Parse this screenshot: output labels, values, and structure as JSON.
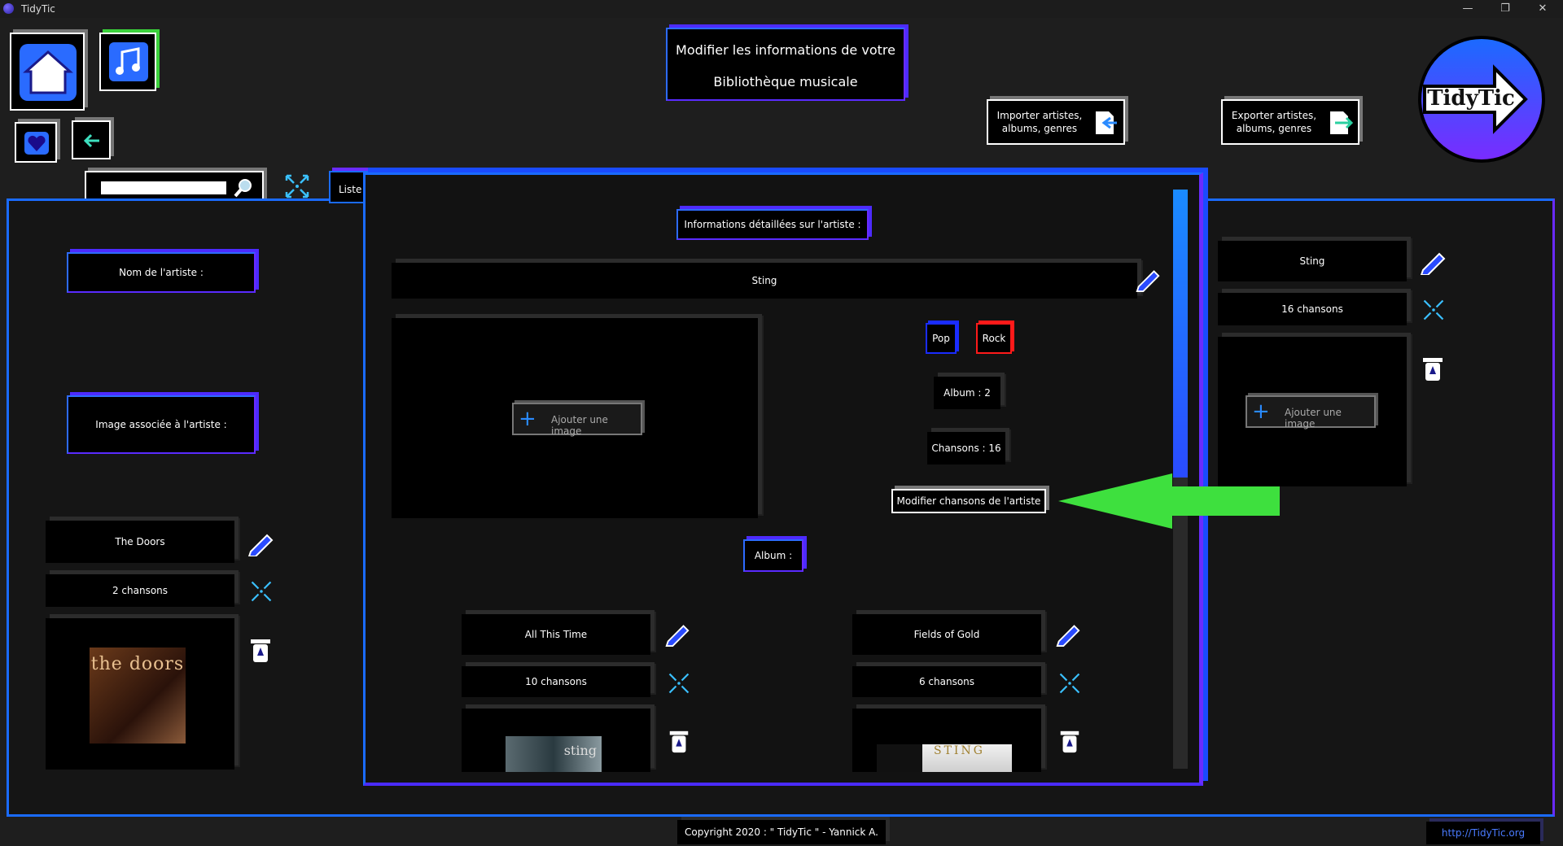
{
  "window": {
    "title": "TidyTic",
    "controls": [
      "—",
      "❐",
      "✕"
    ]
  },
  "header": {
    "title_line1": "Modifier les informations de votre",
    "title_line2": "Bibliothèque musicale",
    "import_label_line1": "Importer artistes,",
    "import_label_line2": "albums, genres",
    "export_label_line1": "Exporter artistes,",
    "export_label_line2": "albums, genres",
    "logo_text": "TidyTic"
  },
  "toolbar": {
    "search_value": "",
    "list_tab_label": "Liste"
  },
  "left_panel": {
    "artist_name_label": "Nom de l'artiste :",
    "artist_image_label": "Image associée à l'artiste :",
    "artist": {
      "name": "The Doors",
      "songs": "2 chansons",
      "cover_text": "the doors"
    }
  },
  "modal": {
    "heading": "Informations détaillées sur l'artiste :",
    "artist_name": "Sting",
    "add_image_label": "Ajouter une image",
    "genres": [
      {
        "label": "Pop",
        "color": "#1a2cff"
      },
      {
        "label": "Rock",
        "color": "#ff1a1a"
      }
    ],
    "album_count": "Album  : 2",
    "song_count": "Chansons  : 16",
    "edit_songs_label": "Modifier chansons de l'artiste",
    "album_section_label": "Album  :",
    "albums": [
      {
        "title": "All This Time",
        "songs": "10 chansons",
        "cover_text": "sting"
      },
      {
        "title": "Fields of Gold",
        "songs": "6 chansons",
        "cover_text": "STING"
      }
    ]
  },
  "right_panel": {
    "artist_name": "Sting",
    "songs": "16 chansons",
    "add_image_label": "Ajouter une image"
  },
  "annotation": {
    "arrow_color": "#3ee03e"
  },
  "footer": {
    "copyright": "Copyright 2020 : \" TidyTic \" - Yannick A.",
    "link": "http://TidyTic.org"
  }
}
